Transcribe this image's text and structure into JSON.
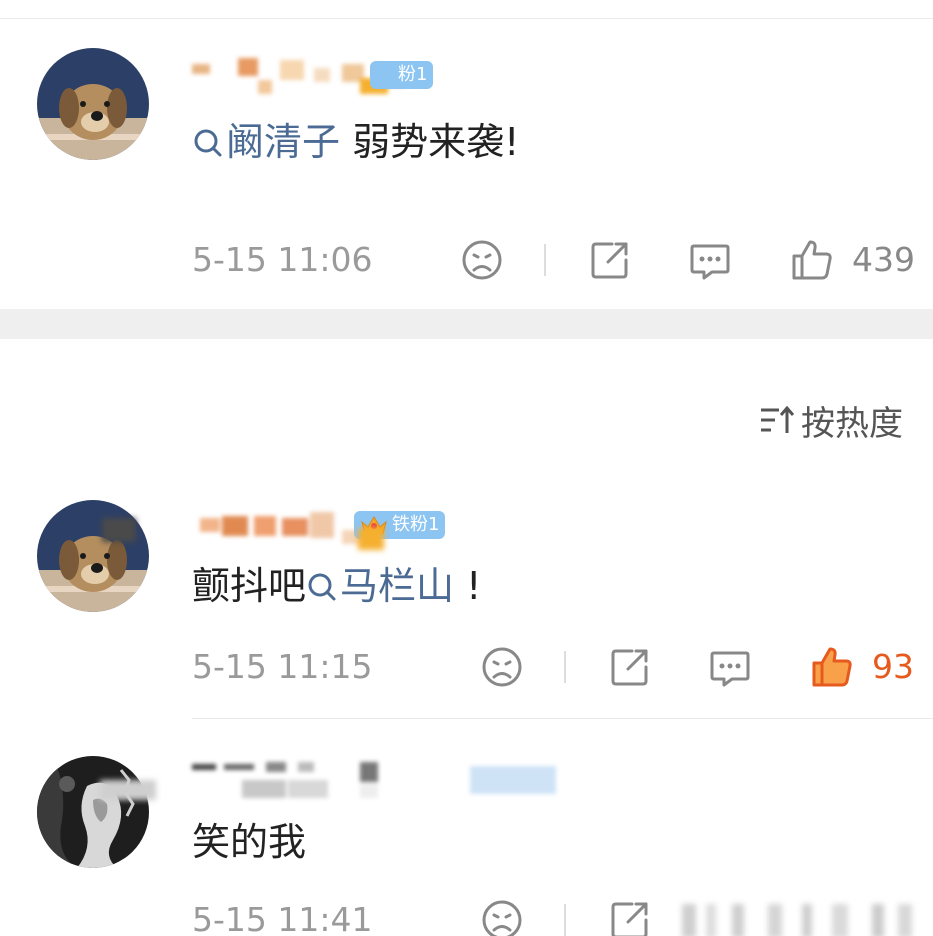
{
  "colors": {
    "accent_blue": "#4c6b94",
    "liked_orange": "#e65a1e",
    "muted_gray": "#9a9a9a",
    "badge_blue": "#8cc4f2"
  },
  "sort_toggle": {
    "label": "按热度",
    "icon": "sort-icon"
  },
  "comments": [
    {
      "avatar": "plush-dog-avatar",
      "badge_text": "粉1",
      "text_parts": [
        {
          "type": "topic",
          "text": "阚清子"
        },
        {
          "type": "text",
          "text": " 弱势来袭!"
        }
      ],
      "time": "5-15 11:06",
      "likes": "439",
      "liked": false
    },
    {
      "avatar": "plush-dog-avatar",
      "badge_text": "铁粉1",
      "text_parts": [
        {
          "type": "text",
          "text": "颤抖吧"
        },
        {
          "type": "topic",
          "text": "马栏山"
        },
        {
          "type": "text",
          "text": " !"
        }
      ],
      "time": "5-15 11:15",
      "likes": "93",
      "liked": true
    },
    {
      "avatar": "dark-portrait-avatar",
      "badge_text": "",
      "text_parts": [
        {
          "type": "text",
          "text": "笑的我"
        }
      ],
      "time": "5-15 11:41",
      "likes": "",
      "liked": false
    }
  ]
}
